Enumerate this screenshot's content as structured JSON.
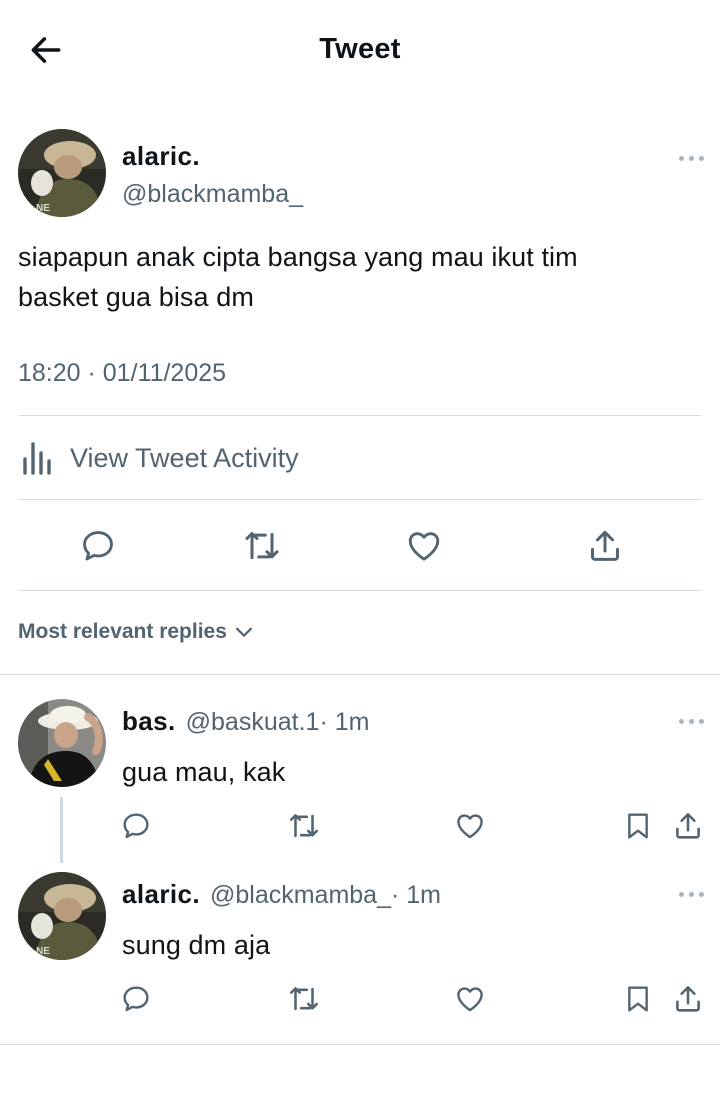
{
  "header": {
    "title": "Tweet"
  },
  "tweet": {
    "author_name": "alaric.",
    "author_handle": "@blackmamba_",
    "text_line1": "siapapun anak cipta bangsa yang mau ikut tim",
    "text_line2": "basket gua bisa dm",
    "timestamp": "18:20 · 01/11/2025",
    "activity_label": "View Tweet Activity"
  },
  "replies_sort": {
    "label": "Most relevant replies"
  },
  "replies": [
    {
      "name": "bas.",
      "handle": "@baskuat.1",
      "time": " · 1m",
      "text": "gua mau, kak"
    },
    {
      "name": "alaric.",
      "handle": "@blackmamba_",
      "time": " · 1m",
      "text": "sung dm aja"
    }
  ],
  "icons": {
    "back": "arrow-left-icon",
    "reply": "comment-icon",
    "retweet": "retweet-icon",
    "like": "heart-icon",
    "share": "share-icon",
    "bookmark": "bookmark-icon",
    "activity": "bar-chart-icon",
    "more": "more-horizontal-icon",
    "chevron": "chevron-down-icon"
  },
  "colors": {
    "text": "#0f1419",
    "secondary": "#536471",
    "divider": "#d6dde3",
    "icon": "#536471"
  }
}
